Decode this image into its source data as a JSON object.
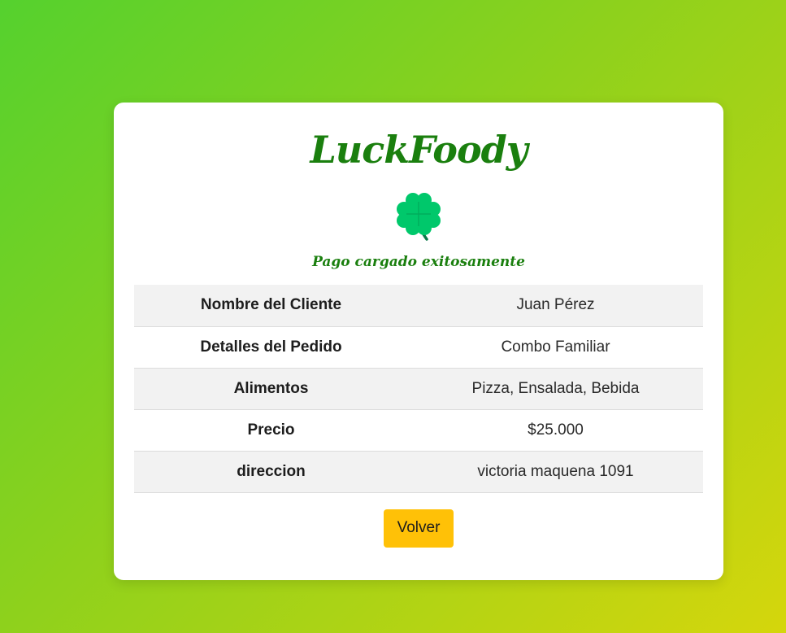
{
  "brand": {
    "name": "LuckFoody",
    "logo_icon": "four-leaf-clover-icon",
    "accent_color": "#1a7f0e"
  },
  "status": {
    "message": "Pago cargado exitosamente"
  },
  "order": {
    "rows": [
      {
        "label": "Nombre del Cliente",
        "value": "Juan Pérez"
      },
      {
        "label": "Detalles del Pedido",
        "value": "Combo Familiar"
      },
      {
        "label": "Alimentos",
        "value": "Pizza, Ensalada, Bebida"
      },
      {
        "label": "Precio",
        "value": "$25.000"
      },
      {
        "label": "direccion",
        "value": "victoria maquena 1091"
      }
    ]
  },
  "actions": {
    "back_label": "Volver",
    "back_color": "#ffc107"
  }
}
